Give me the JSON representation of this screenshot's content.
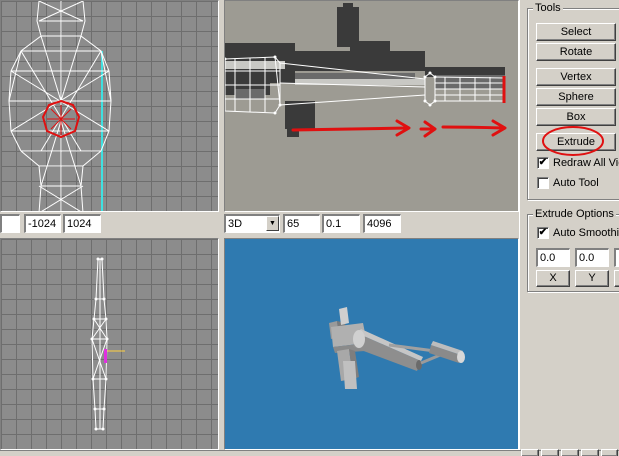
{
  "tools": {
    "title": "Tools",
    "buttons": [
      {
        "label": "Select"
      },
      {
        "label": "Rotate"
      },
      {
        "label": "Vertex"
      },
      {
        "label": "Sphere"
      },
      {
        "label": "Box"
      },
      {
        "label": "Extrude"
      }
    ],
    "redraw_label": "Redraw All Views",
    "redraw_checked": "✔",
    "autotool_label": "Auto Tool",
    "autotool_checked": ""
  },
  "extrude_options": {
    "title": "Extrude Options",
    "auto_smoothing_label": "Auto Smoothing",
    "auto_smoothing_checked": "✔",
    "fields": [
      "0.0",
      "0.0"
    ],
    "axis_buttons": [
      "X",
      "Y"
    ]
  },
  "coords": {
    "left_field": "",
    "min": "-1024",
    "max": "1024"
  },
  "view_controls": {
    "mode": "3D",
    "fov": "65",
    "near": "0.1",
    "far": "4096"
  },
  "colors": {
    "viewport_grey": "#8c8c8c",
    "viewport_blue": "#2f7ab0",
    "wire": "#ffffff",
    "highlight": "#e01010",
    "panel": "#d4d0c8"
  }
}
